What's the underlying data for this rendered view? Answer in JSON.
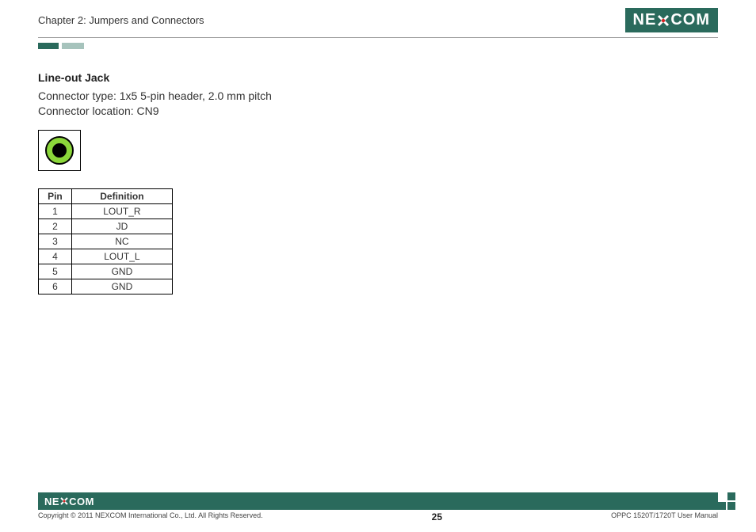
{
  "header": {
    "chapter": "Chapter 2: Jumpers and Connectors",
    "logo_pre": "NE",
    "logo_post": "COM"
  },
  "section": {
    "heading": "Line-out Jack",
    "spec1": "Connector type: 1x5 5-pin header, 2.0 mm pitch",
    "spec2": "Connector location: CN9"
  },
  "table": {
    "col_pin": "Pin",
    "col_def": "Definition",
    "rows": [
      {
        "pin": "1",
        "def": "LOUT_R"
      },
      {
        "pin": "2",
        "def": "JD"
      },
      {
        "pin": "3",
        "def": "NC"
      },
      {
        "pin": "4",
        "def": "LOUT_L"
      },
      {
        "pin": "5",
        "def": "GND"
      },
      {
        "pin": "6",
        "def": "GND"
      }
    ]
  },
  "footer": {
    "logo_pre": "NE",
    "logo_post": "COM",
    "copyright": "Copyright © 2011 NEXCOM International Co., Ltd. All Rights Reserved.",
    "page": "25",
    "manual": "OPPC 1520T/1720T User Manual"
  }
}
